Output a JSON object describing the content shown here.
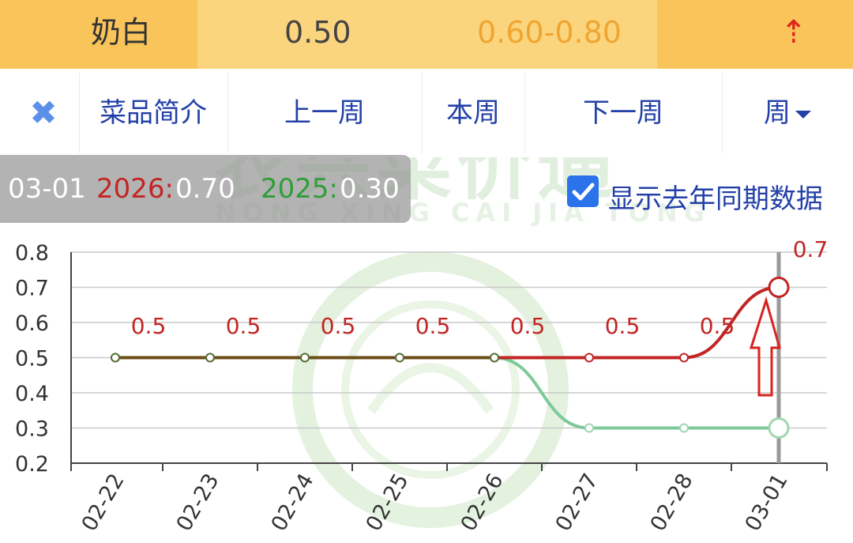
{
  "item": {
    "name": "奶白",
    "price": "0.50",
    "range": "0.60-0.80",
    "trend_icon": "up-dashed-arrow-icon"
  },
  "toolbar": {
    "close_icon": "close-x-icon",
    "intro_label": "菜品简介",
    "prev_week_label": "上一周",
    "this_week_label": "本周",
    "next_week_label": "下一周",
    "period_label": "周"
  },
  "watermark": {
    "cn": "农兴菜价通",
    "en": "NONG XING CAI JIA TONG"
  },
  "tooltip": {
    "date": "03-01",
    "current_year": "2026:",
    "current_value": "0.70",
    "previous_year": "2025:",
    "previous_value": "0.30"
  },
  "show_last_year": {
    "checked": true,
    "label": "显示去年同期数据"
  },
  "colors": {
    "header_bg": "#f9c45a",
    "current_line": "#c22524",
    "previous_line": "#7ec999",
    "link_blue": "#2340a8"
  },
  "chart_data": {
    "type": "line",
    "categories": [
      "02-22",
      "02-23",
      "02-24",
      "02-25",
      "02-26",
      "02-27",
      "02-28",
      "03-01"
    ],
    "series": [
      {
        "name": "2026",
        "values": [
          0.5,
          0.5,
          0.5,
          0.5,
          0.5,
          0.5,
          0.5,
          0.7
        ]
      },
      {
        "name": "2025",
        "values": [
          0.5,
          0.5,
          0.5,
          0.5,
          0.5,
          0.3,
          0.3,
          0.3
        ]
      }
    ],
    "data_labels": [
      "0.5",
      "0.5",
      "0.5",
      "0.5",
      "0.5",
      "0.5",
      "0.5",
      "0.7"
    ],
    "yticks": [
      "0.8",
      "0.7",
      "0.6",
      "0.5",
      "0.4",
      "0.3",
      "0.2"
    ],
    "ylim": [
      0.2,
      0.8
    ],
    "grid": true,
    "highlighted_category": "03-01"
  }
}
